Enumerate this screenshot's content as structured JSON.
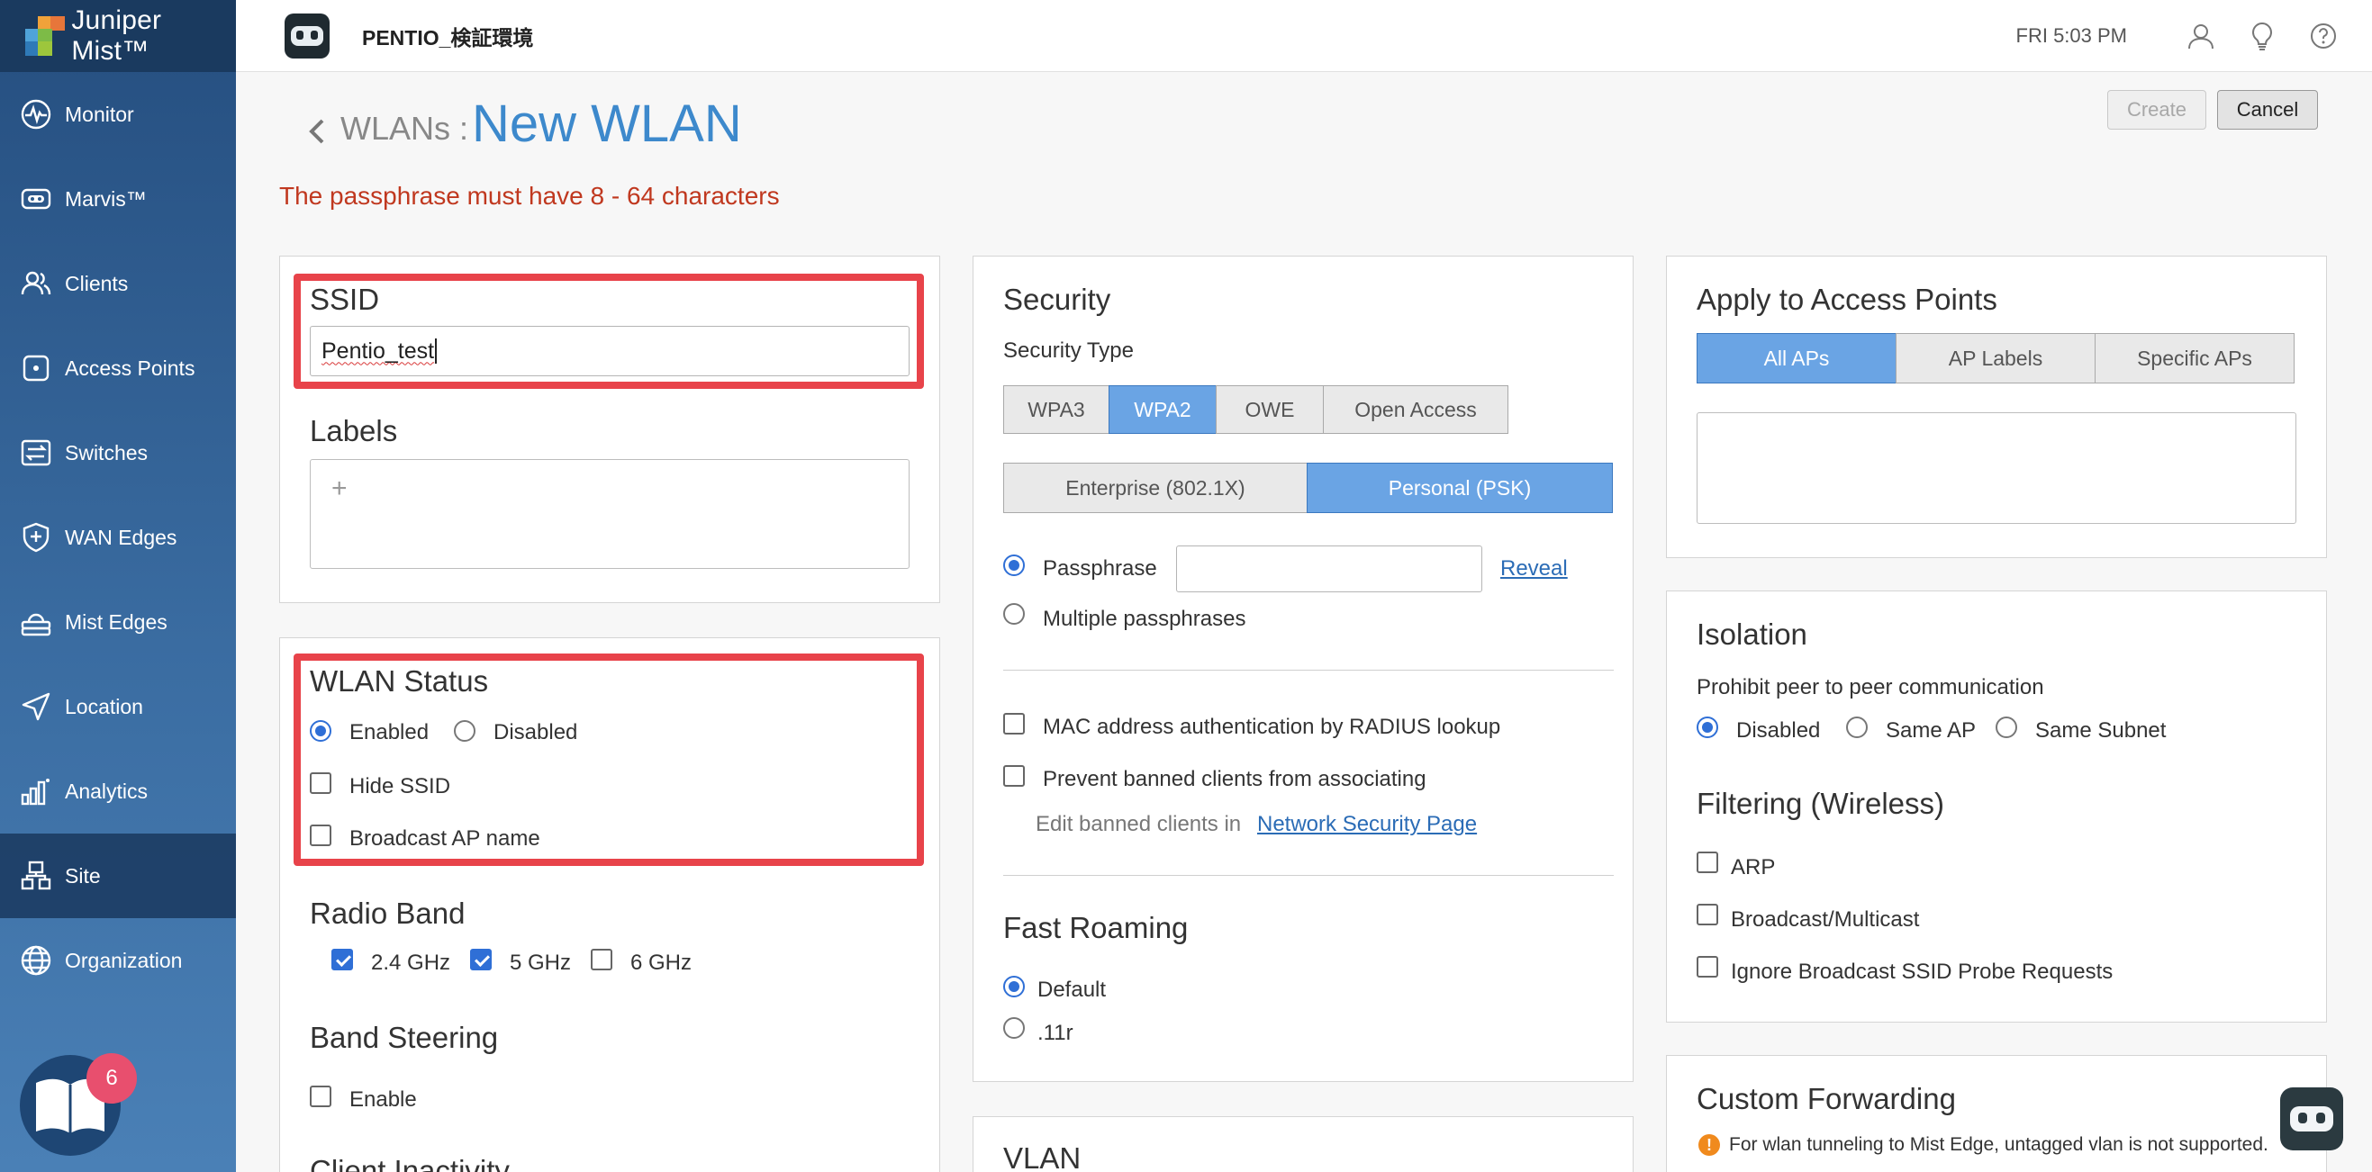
{
  "brand": {
    "name": "Juniper Mist™"
  },
  "nav": [
    {
      "label": "Monitor",
      "icon": "monitor-pulse-icon"
    },
    {
      "label": "Marvis™",
      "icon": "marvis-icon"
    },
    {
      "label": "Clients",
      "icon": "clients-icon"
    },
    {
      "label": "Access Points",
      "icon": "access-point-icon"
    },
    {
      "label": "Switches",
      "icon": "switch-icon"
    },
    {
      "label": "WAN Edges",
      "icon": "wan-edge-icon"
    },
    {
      "label": "Mist Edges",
      "icon": "mist-edge-icon"
    },
    {
      "label": "Location",
      "icon": "location-arrow-icon"
    },
    {
      "label": "Analytics",
      "icon": "analytics-bar-icon"
    },
    {
      "label": "Site",
      "icon": "site-icon",
      "active": true
    },
    {
      "label": "Organization",
      "icon": "globe-icon"
    }
  ],
  "help": {
    "badge_count": "6"
  },
  "topbar": {
    "site_name": "PENTIO_検証環境",
    "clock": "FRI 5:03 PM"
  },
  "page": {
    "breadcrumb": "WLANs :",
    "title": "New WLAN",
    "create_label": "Create",
    "cancel_label": "Cancel",
    "error": "The passphrase must have 8 - 64 characters"
  },
  "ssid": {
    "heading": "SSID",
    "value": "Pentio_test"
  },
  "labels": {
    "heading": "Labels",
    "add": "+"
  },
  "wlan_status": {
    "heading": "WLAN Status",
    "enabled": "Enabled",
    "disabled": "Disabled",
    "hide_ssid": "Hide SSID",
    "broadcast_ap": "Broadcast AP name"
  },
  "radio_band": {
    "heading": "Radio Band",
    "b24": "2.4 GHz",
    "b5": "5 GHz",
    "b6": "6 GHz"
  },
  "band_steering": {
    "heading": "Band Steering",
    "enable": "Enable"
  },
  "client_inactivity": {
    "heading": "Client Inactivity"
  },
  "security": {
    "heading": "Security",
    "type_label": "Security Type",
    "types": [
      "WPA3",
      "WPA2",
      "OWE",
      "Open Access"
    ],
    "modes": [
      "Enterprise (802.1X)",
      "Personal (PSK)"
    ],
    "passphrase": "Passphrase",
    "passphrase_value": "",
    "reveal": "Reveal",
    "multiple": "Multiple passphrases",
    "mac_auth": "MAC address authentication by RADIUS lookup",
    "prevent_banned": "Prevent banned clients from associating",
    "edit_banned_prefix": "Edit banned clients in",
    "edit_banned_link": "Network Security Page"
  },
  "fast_roaming": {
    "heading": "Fast Roaming",
    "default": "Default",
    "r11": ".11r"
  },
  "vlan": {
    "heading": "VLAN"
  },
  "apply": {
    "heading": "Apply to Access Points",
    "tabs": [
      "All APs",
      "AP Labels",
      "Specific APs"
    ]
  },
  "isolation": {
    "heading": "Isolation",
    "sub": "Prohibit peer to peer communication",
    "disabled": "Disabled",
    "same_ap": "Same AP",
    "same_subnet": "Same Subnet"
  },
  "filtering": {
    "heading": "Filtering (Wireless)",
    "arp": "ARP",
    "bcast": "Broadcast/Multicast",
    "ignore": "Ignore Broadcast SSID Probe Requests"
  },
  "custom_fwd": {
    "heading": "Custom Forwarding",
    "note": "For wlan tunneling to Mist Edge, untagged vlan is not supported."
  },
  "colors": {
    "accent": "#3d89cc",
    "error": "#c0381f",
    "highlight": "#e8434a",
    "selected_segment": "#6aa4e4"
  }
}
